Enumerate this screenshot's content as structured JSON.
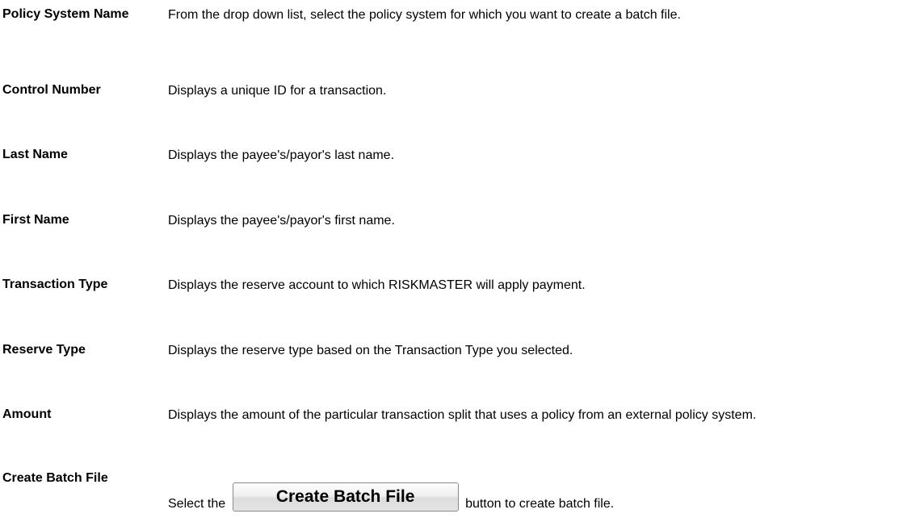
{
  "fields": [
    {
      "term": "Policy System Name",
      "description": "From the drop down list, select the policy system for which you want to create a batch file."
    },
    {
      "term": "Control Number",
      "description": "Displays a unique ID for a transaction."
    },
    {
      "term": "Last Name",
      "description": "Displays the payee's/payor's last name."
    },
    {
      "term": "First Name",
      "description": "Displays the payee's/payor's first name."
    },
    {
      "term": "Transaction Type",
      "description": "Displays the reserve account to which RISKMASTER will apply payment."
    },
    {
      "term": "Reserve Type",
      "description": "Displays the reserve type based on the Transaction Type you selected."
    },
    {
      "term": "Amount",
      "description": "Displays the amount of the particular transaction split that uses a policy from an external policy system."
    }
  ],
  "create_batch": {
    "term": "Create Batch File",
    "prefix": "Select the",
    "button_label": "Create Batch File",
    "suffix": "button to create batch file."
  }
}
